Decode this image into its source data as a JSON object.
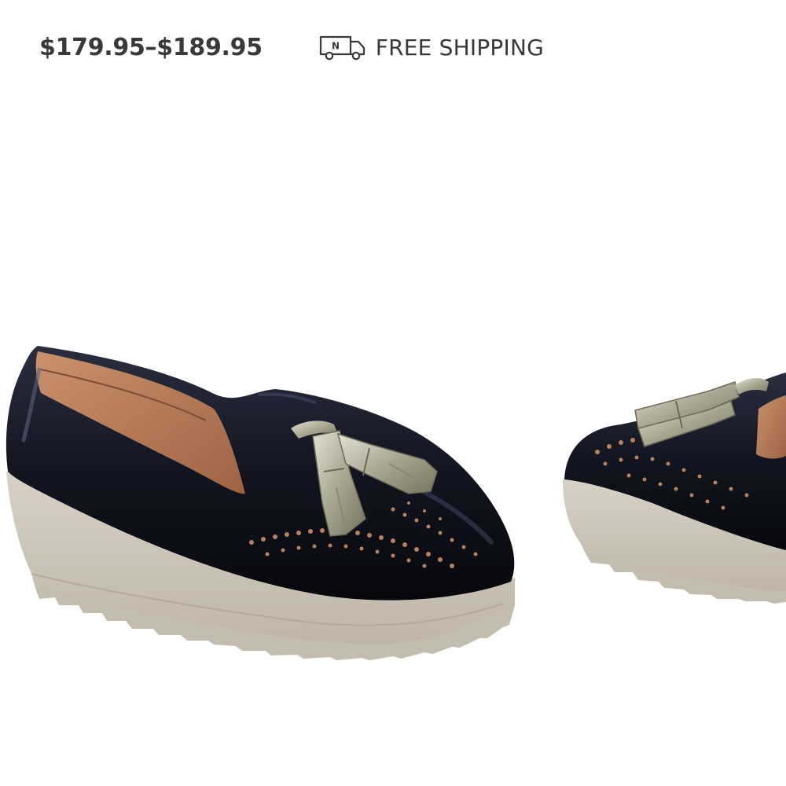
{
  "product": {
    "price_range": "$179.95–$189.95",
    "shipping_label": "FREE SHIPPING",
    "shipping_icon_letter": "N",
    "image": {
      "main_shoe": "black patent tassel loafer with beige lug wedge sole",
      "secondary_shoe": "cropped side view of matching shoe"
    }
  },
  "colors": {
    "text": "#393939",
    "shoe_upper": "#12141f",
    "sole": "#ccc4b7",
    "lining": "#b9805c",
    "tassel": "#b9b6a6"
  }
}
